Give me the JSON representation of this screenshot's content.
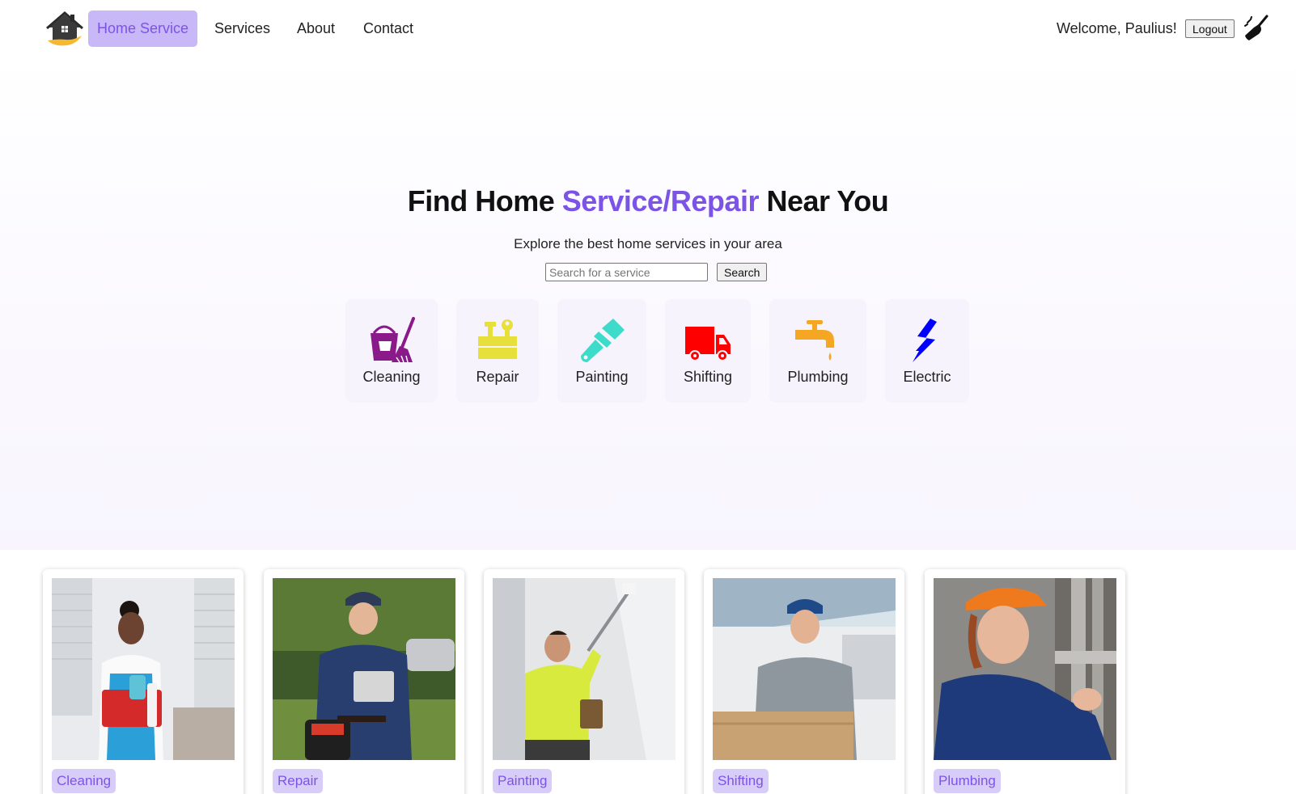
{
  "nav": {
    "brand": "Home Service",
    "links": [
      "Services",
      "About",
      "Contact"
    ],
    "welcome": "Welcome, Paulius!",
    "logout_label": "Logout",
    "accent_color": "#7b54e6",
    "brand_bg": "#c9b8f7"
  },
  "hero": {
    "title_start": "Find Home ",
    "title_accent": "Service/Repair",
    "title_end": " Near You",
    "subtitle": "Explore the best home services in your area",
    "search_placeholder": "Search for a service",
    "search_button": "Search"
  },
  "categories": [
    {
      "label": "Cleaning",
      "icon": "cleaning-bucket-icon",
      "color": "#8a1a8a"
    },
    {
      "label": "Repair",
      "icon": "toolbox-icon",
      "color": "#e8e03a"
    },
    {
      "label": "Painting",
      "icon": "paint-brush-icon",
      "color": "#3ddbc9"
    },
    {
      "label": "Shifting",
      "icon": "truck-icon",
      "color": "#ff0000"
    },
    {
      "label": "Plumbing",
      "icon": "faucet-icon",
      "color": "#f5a623"
    },
    {
      "label": "Electric",
      "icon": "lightning-icon",
      "color": "#0000ff"
    }
  ],
  "cards": [
    {
      "tag": "Cleaning"
    },
    {
      "tag": "Repair"
    },
    {
      "tag": "Painting"
    },
    {
      "tag": "Shifting"
    },
    {
      "tag": "Plumbing"
    }
  ]
}
